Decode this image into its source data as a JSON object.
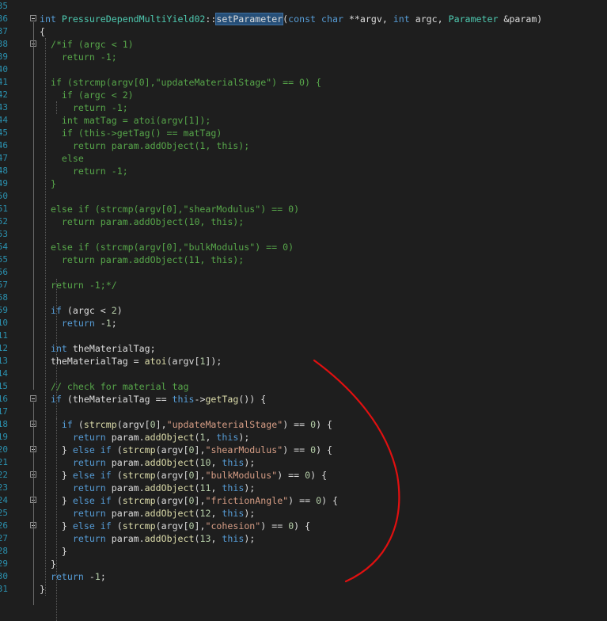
{
  "editor": {
    "language": "C++",
    "colors": {
      "background": "#1e1e1e",
      "line_number": "#2b91af",
      "keyword": "#569cd6",
      "type": "#4ec9b0",
      "string": "#d69d85",
      "comment": "#57a64a",
      "function": "#dcdcaa",
      "number": "#b5cea8",
      "text": "#dcdcdc",
      "annotation": "#e01010"
    },
    "lines": [
      {
        "num": "35",
        "fold": false,
        "segs": []
      },
      {
        "num": "36",
        "fold": true,
        "segs": [
          [
            "int",
            "kw"
          ],
          [
            " PressureDependMultiYield02",
            "type"
          ],
          [
            "::",
            ""
          ],
          [
            "setParameter",
            "hl"
          ],
          [
            "(",
            ""
          ],
          [
            "const",
            "kw"
          ],
          [
            " ",
            ""
          ],
          [
            "char",
            "kw"
          ],
          [
            " **argv, ",
            ""
          ],
          [
            "int",
            "kw"
          ],
          [
            " argc, ",
            ""
          ],
          [
            "Parameter",
            "type"
          ],
          [
            " &param)",
            ""
          ]
        ]
      },
      {
        "num": "37",
        "fold": false,
        "segs": [
          [
            "{",
            ""
          ]
        ]
      },
      {
        "num": "38",
        "fold": true,
        "segs": [
          [
            "  /*if (argc < 1)",
            "cmt"
          ]
        ]
      },
      {
        "num": "39",
        "fold": false,
        "segs": [
          [
            "    return -1;",
            "cmt"
          ]
        ]
      },
      {
        "num": "40",
        "fold": false,
        "segs": []
      },
      {
        "num": "41",
        "fold": false,
        "segs": [
          [
            "  if (strcmp(argv[0],\"updateMaterialStage\") == 0) {",
            "cmt"
          ]
        ]
      },
      {
        "num": "42",
        "fold": false,
        "segs": [
          [
            "    if (argc < 2)",
            "cmt"
          ]
        ]
      },
      {
        "num": "43",
        "fold": false,
        "segs": [
          [
            "      return -1;",
            "cmt"
          ]
        ]
      },
      {
        "num": "44",
        "fold": false,
        "segs": [
          [
            "    int matTag = atoi(argv[1]);",
            "cmt"
          ]
        ]
      },
      {
        "num": "45",
        "fold": false,
        "segs": [
          [
            "    if (this->getTag() == matTag)",
            "cmt"
          ]
        ]
      },
      {
        "num": "46",
        "fold": false,
        "segs": [
          [
            "      return param.addObject(1, this);",
            "cmt"
          ]
        ]
      },
      {
        "num": "47",
        "fold": false,
        "segs": [
          [
            "    else",
            "cmt"
          ]
        ]
      },
      {
        "num": "48",
        "fold": false,
        "segs": [
          [
            "      return -1;",
            "cmt"
          ]
        ]
      },
      {
        "num": "49",
        "fold": false,
        "segs": [
          [
            "  }",
            "cmt"
          ]
        ]
      },
      {
        "num": "50",
        "fold": false,
        "segs": []
      },
      {
        "num": "51",
        "fold": false,
        "segs": [
          [
            "  else if (strcmp(argv[0],\"shearModulus\") == 0)",
            "cmt"
          ]
        ]
      },
      {
        "num": "52",
        "fold": false,
        "segs": [
          [
            "    return param.addObject(10, this);",
            "cmt"
          ]
        ]
      },
      {
        "num": "53",
        "fold": false,
        "segs": []
      },
      {
        "num": "54",
        "fold": false,
        "segs": [
          [
            "  else if (strcmp(argv[0],\"bulkModulus\") == 0)",
            "cmt"
          ]
        ]
      },
      {
        "num": "55",
        "fold": false,
        "segs": [
          [
            "    return param.addObject(11, this);",
            "cmt"
          ]
        ]
      },
      {
        "num": "56",
        "fold": false,
        "segs": []
      },
      {
        "num": "57",
        "fold": false,
        "segs": [
          [
            "  return -1;*/",
            "cmt"
          ]
        ]
      },
      {
        "num": "58",
        "fold": false,
        "segs": []
      },
      {
        "num": "59",
        "fold": false,
        "segs": [
          [
            "  ",
            ""
          ],
          [
            "if",
            "kw"
          ],
          [
            " (argc < ",
            ""
          ],
          [
            "2",
            "num"
          ],
          [
            ")",
            ""
          ]
        ]
      },
      {
        "num": "10",
        "fold": false,
        "segs": [
          [
            "    ",
            ""
          ],
          [
            "return",
            "kw"
          ],
          [
            " -",
            ""
          ],
          [
            "1",
            "num"
          ],
          [
            ";",
            ""
          ]
        ]
      },
      {
        "num": "11",
        "fold": false,
        "segs": []
      },
      {
        "num": "12",
        "fold": false,
        "segs": [
          [
            "  ",
            ""
          ],
          [
            "int",
            "kw"
          ],
          [
            " theMaterialTag;",
            ""
          ]
        ]
      },
      {
        "num": "13",
        "fold": false,
        "segs": [
          [
            "  theMaterialTag = ",
            ""
          ],
          [
            "atoi",
            "fn"
          ],
          [
            "(argv[",
            ""
          ],
          [
            "1",
            "num"
          ],
          [
            "]);",
            ""
          ]
        ]
      },
      {
        "num": "14",
        "fold": false,
        "segs": []
      },
      {
        "num": "15",
        "fold": false,
        "segs": [
          [
            "  // check for material tag",
            "cmt"
          ]
        ]
      },
      {
        "num": "16",
        "fold": true,
        "segs": [
          [
            "  ",
            ""
          ],
          [
            "if",
            "kw"
          ],
          [
            " (theMaterialTag == ",
            ""
          ],
          [
            "this",
            "kw"
          ],
          [
            "->",
            ""
          ],
          [
            "getTag",
            "fn"
          ],
          [
            "()) {",
            ""
          ]
        ]
      },
      {
        "num": "17",
        "fold": false,
        "segs": []
      },
      {
        "num": "18",
        "fold": true,
        "segs": [
          [
            "    ",
            ""
          ],
          [
            "if",
            "kw"
          ],
          [
            " (",
            ""
          ],
          [
            "strcmp",
            "fn"
          ],
          [
            "(argv[",
            ""
          ],
          [
            "0",
            "num"
          ],
          [
            "],",
            ""
          ],
          [
            "\"updateMaterialStage\"",
            "str"
          ],
          [
            ") == ",
            ""
          ],
          [
            "0",
            "num"
          ],
          [
            ") {",
            ""
          ]
        ]
      },
      {
        "num": "19",
        "fold": false,
        "segs": [
          [
            "      ",
            ""
          ],
          [
            "return",
            "kw"
          ],
          [
            " param.",
            ""
          ],
          [
            "addObject",
            "fn"
          ],
          [
            "(",
            ""
          ],
          [
            "1",
            "num"
          ],
          [
            ", ",
            ""
          ],
          [
            "this",
            "kw"
          ],
          [
            ");",
            ""
          ]
        ]
      },
      {
        "num": "20",
        "fold": true,
        "segs": [
          [
            "    } ",
            ""
          ],
          [
            "else",
            "kw"
          ],
          [
            " ",
            ""
          ],
          [
            "if",
            "kw"
          ],
          [
            " (",
            ""
          ],
          [
            "strcmp",
            "fn"
          ],
          [
            "(argv[",
            ""
          ],
          [
            "0",
            "num"
          ],
          [
            "],",
            ""
          ],
          [
            "\"shearModulus\"",
            "str"
          ],
          [
            ") == ",
            ""
          ],
          [
            "0",
            "num"
          ],
          [
            ") {",
            ""
          ]
        ]
      },
      {
        "num": "21",
        "fold": false,
        "segs": [
          [
            "      ",
            ""
          ],
          [
            "return",
            "kw"
          ],
          [
            " param.",
            ""
          ],
          [
            "addObject",
            "fn"
          ],
          [
            "(",
            ""
          ],
          [
            "10",
            "num"
          ],
          [
            ", ",
            ""
          ],
          [
            "this",
            "kw"
          ],
          [
            ");",
            ""
          ]
        ]
      },
      {
        "num": "22",
        "fold": true,
        "segs": [
          [
            "    } ",
            ""
          ],
          [
            "else",
            "kw"
          ],
          [
            " ",
            ""
          ],
          [
            "if",
            "kw"
          ],
          [
            " (",
            ""
          ],
          [
            "strcmp",
            "fn"
          ],
          [
            "(argv[",
            ""
          ],
          [
            "0",
            "num"
          ],
          [
            "],",
            ""
          ],
          [
            "\"bulkModulus\"",
            "str"
          ],
          [
            ") == ",
            ""
          ],
          [
            "0",
            "num"
          ],
          [
            ") {",
            ""
          ]
        ]
      },
      {
        "num": "23",
        "fold": false,
        "segs": [
          [
            "      ",
            ""
          ],
          [
            "return",
            "kw"
          ],
          [
            " param.",
            ""
          ],
          [
            "addObject",
            "fn"
          ],
          [
            "(",
            ""
          ],
          [
            "11",
            "num"
          ],
          [
            ", ",
            ""
          ],
          [
            "this",
            "kw"
          ],
          [
            ");",
            ""
          ]
        ]
      },
      {
        "num": "24",
        "fold": true,
        "segs": [
          [
            "    } ",
            ""
          ],
          [
            "else",
            "kw"
          ],
          [
            " ",
            ""
          ],
          [
            "if",
            "kw"
          ],
          [
            " (",
            ""
          ],
          [
            "strcmp",
            "fn"
          ],
          [
            "(argv[",
            ""
          ],
          [
            "0",
            "num"
          ],
          [
            "],",
            ""
          ],
          [
            "\"frictionAngle\"",
            "str"
          ],
          [
            ") == ",
            ""
          ],
          [
            "0",
            "num"
          ],
          [
            ") {",
            ""
          ]
        ]
      },
      {
        "num": "25",
        "fold": false,
        "segs": [
          [
            "      ",
            ""
          ],
          [
            "return",
            "kw"
          ],
          [
            " param.",
            ""
          ],
          [
            "addObject",
            "fn"
          ],
          [
            "(",
            ""
          ],
          [
            "12",
            "num"
          ],
          [
            ", ",
            ""
          ],
          [
            "this",
            "kw"
          ],
          [
            ");",
            ""
          ]
        ]
      },
      {
        "num": "26",
        "fold": true,
        "segs": [
          [
            "    } ",
            ""
          ],
          [
            "else",
            "kw"
          ],
          [
            " ",
            ""
          ],
          [
            "if",
            "kw"
          ],
          [
            " (",
            ""
          ],
          [
            "strcmp",
            "fn"
          ],
          [
            "(argv[",
            ""
          ],
          [
            "0",
            "num"
          ],
          [
            "],",
            ""
          ],
          [
            "\"cohesion\"",
            "str"
          ],
          [
            ") == ",
            ""
          ],
          [
            "0",
            "num"
          ],
          [
            ") {",
            ""
          ]
        ]
      },
      {
        "num": "27",
        "fold": false,
        "segs": [
          [
            "      ",
            ""
          ],
          [
            "return",
            "kw"
          ],
          [
            " param.",
            ""
          ],
          [
            "addObject",
            "fn"
          ],
          [
            "(",
            ""
          ],
          [
            "13",
            "num"
          ],
          [
            ", ",
            ""
          ],
          [
            "this",
            "kw"
          ],
          [
            ");",
            ""
          ]
        ]
      },
      {
        "num": "28",
        "fold": false,
        "segs": [
          [
            "    }",
            ""
          ]
        ]
      },
      {
        "num": "29",
        "fold": false,
        "segs": [
          [
            "  }",
            ""
          ]
        ]
      },
      {
        "num": "30",
        "fold": false,
        "segs": [
          [
            "  ",
            ""
          ],
          [
            "return",
            "kw"
          ],
          [
            " -",
            ""
          ],
          [
            "1",
            "num"
          ],
          [
            ";",
            ""
          ]
        ]
      },
      {
        "num": "31",
        "fold": false,
        "segs": [
          [
            "}",
            ""
          ]
        ]
      }
    ]
  }
}
